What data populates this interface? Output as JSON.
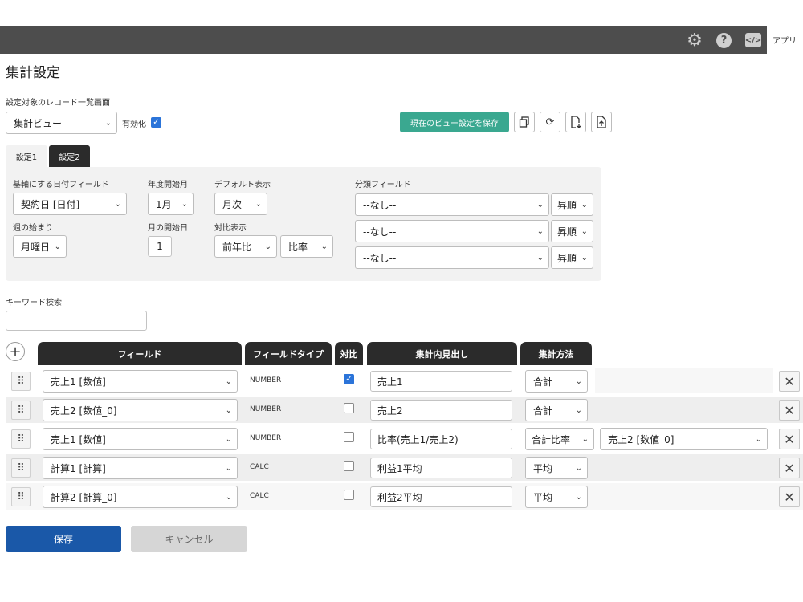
{
  "header": {
    "app_name": "アプリ"
  },
  "page": {
    "title": "集計設定"
  },
  "view": {
    "label": "設定対象のレコード一覧画面",
    "selected": "集計ビュー",
    "enabled_label": "有効化",
    "save_view_label": "現在のビュー設定を保存"
  },
  "tabs": [
    {
      "label": "設定1"
    },
    {
      "label": "設定2"
    }
  ],
  "settings": {
    "base_date_field_label": "基軸にする日付フィールド",
    "base_date_field_value": "契約日 [日付]",
    "fiscal_start_month_label": "年度開始月",
    "fiscal_start_month_value": "1月",
    "default_display_label": "デフォルト表示",
    "default_display_value": "月次",
    "week_start_label": "週の始まり",
    "week_start_value": "月曜日",
    "month_start_day_label": "月の開始日",
    "month_start_day_value": "1",
    "compare_label": "対比表示",
    "compare_value1": "前年比",
    "compare_value2": "比率",
    "category_field_label": "分類フィールド",
    "category_rows": [
      {
        "field": "--なし--",
        "order": "昇順"
      },
      {
        "field": "--なし--",
        "order": "昇順"
      },
      {
        "field": "--なし--",
        "order": "昇順"
      }
    ]
  },
  "keyword": {
    "label": "キーワード検索",
    "value": ""
  },
  "table": {
    "headers": {
      "field": "フィールド",
      "field_type": "フィールドタイプ",
      "compare": "対比",
      "heading": "集計内見出し",
      "method": "集計方法"
    },
    "rows": [
      {
        "field": "売上1 [数値]",
        "type": "NUMBER",
        "heading": "売上1",
        "method": "合計",
        "extra": ""
      },
      {
        "field": "売上2 [数値_0]",
        "type": "NUMBER",
        "heading": "売上2",
        "method": "合計",
        "extra": ""
      },
      {
        "field": "売上1 [数値]",
        "type": "NUMBER",
        "heading": "比率(売上1/売上2)",
        "method": "合計比率",
        "extra": "売上2 [数値_0]"
      },
      {
        "field": "計算1 [計算]",
        "type": "CALC",
        "heading": "利益1平均",
        "method": "平均",
        "extra": ""
      },
      {
        "field": "計算2 [計算_0]",
        "type": "CALC",
        "heading": "利益2平均",
        "method": "平均",
        "extra": ""
      }
    ]
  },
  "footer": {
    "save_label": "保存",
    "cancel_label": "キャンセル"
  },
  "colors": {
    "topbar": "#4d4d4d",
    "accent_green": "#3aa890",
    "primary_blue": "#1a58a8",
    "header_dark": "#2b2b2b"
  },
  "icons": [
    "gear-icon",
    "help-icon",
    "code-icon",
    "copy-icon",
    "reset-icon",
    "export-icon",
    "import-icon",
    "plus-icon",
    "drag-handle-icon",
    "close-icon",
    "chevron-down-icon",
    "checkmark-icon"
  ]
}
